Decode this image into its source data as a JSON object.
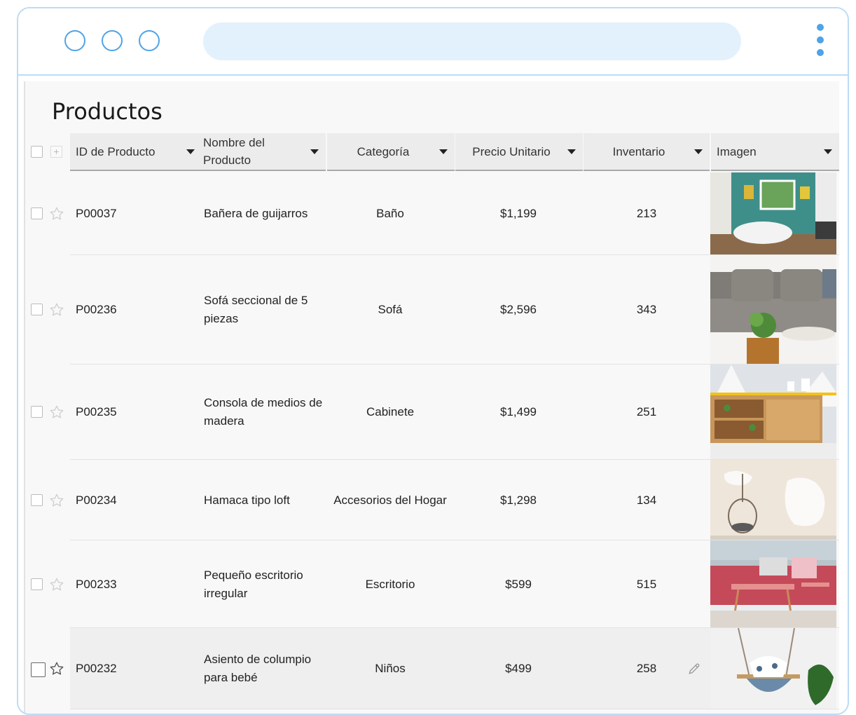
{
  "window": {
    "controls": [
      "circle-button",
      "circle-button",
      "circle-button"
    ],
    "menu_icon": "more-vertical-icon"
  },
  "page": {
    "title": "Productos"
  },
  "table": {
    "columns": [
      {
        "key": "id",
        "label": "ID de Producto"
      },
      {
        "key": "name",
        "label": "Nombre del Producto"
      },
      {
        "key": "category",
        "label": "Categoría"
      },
      {
        "key": "price",
        "label": "Precio Unitario"
      },
      {
        "key": "inventory",
        "label": "Inventario"
      },
      {
        "key": "image",
        "label": "Imagen"
      }
    ],
    "rows": [
      {
        "id": "P00037",
        "name": "Bañera de guijarros",
        "category": "Baño",
        "price": "$1,199",
        "inventory": "213",
        "image": "bathroom-photo"
      },
      {
        "id": "P00236",
        "name": "Sofá seccional de 5 piezas",
        "category": "Sofá",
        "price": "$2,596",
        "inventory": "343",
        "image": "sofa-photo"
      },
      {
        "id": "P00235",
        "name": "Consola de medios de madera",
        "category": "Cabinete",
        "price": "$1,499",
        "inventory": "251",
        "image": "cabinet-photo"
      },
      {
        "id": "P00234",
        "name": "Hamaca tipo loft",
        "category": "Accesorios del Hogar",
        "price": "$1,298",
        "inventory": "134",
        "image": "hammock-photo"
      },
      {
        "id": "P00233",
        "name": "Pequeño escritorio irregular",
        "category": "Escritorio",
        "price": "$599",
        "inventory": "515",
        "image": "desk-photo"
      },
      {
        "id": "P00232",
        "name": "Asiento de columpio para bebé",
        "category": "Niños",
        "price": "$499",
        "inventory": "258",
        "image": "swing-photo"
      }
    ]
  }
}
